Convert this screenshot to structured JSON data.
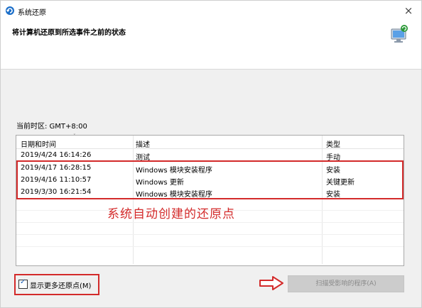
{
  "window": {
    "title": "系统还原",
    "close_glyph": "×"
  },
  "header": {
    "title": "将计算机还原到所选事件之前的状态",
    "icon": "system-restore-monitor-icon"
  },
  "timezone": {
    "label": "当前时区: GMT+8:00"
  },
  "table": {
    "columns": [
      "日期和时间",
      "描述",
      "类型"
    ],
    "sort_indicator": "˅",
    "rows": [
      {
        "datetime": "2019/4/24 16:14:26",
        "description": "测试",
        "type": "手动"
      },
      {
        "datetime": "2019/4/17 16:28:15",
        "description": "Windows 模块安装程序",
        "type": "安装"
      },
      {
        "datetime": "2019/4/16 11:10:57",
        "description": "Windows 更新",
        "type": "关键更新"
      },
      {
        "datetime": "2019/3/30 16:21:54",
        "description": "Windows 模块安装程序",
        "type": "安装"
      }
    ]
  },
  "annotation": {
    "text": "系统自动创建的还原点",
    "color": "#d32a2a"
  },
  "show_more": {
    "label": "显示更多还原点(M)",
    "checked": true
  },
  "scan_button": {
    "label": "扫描受影响的程序(A)",
    "enabled": false
  },
  "colors": {
    "highlight_red": "#d32a2a",
    "panel_bg": "#f0f0f0"
  }
}
